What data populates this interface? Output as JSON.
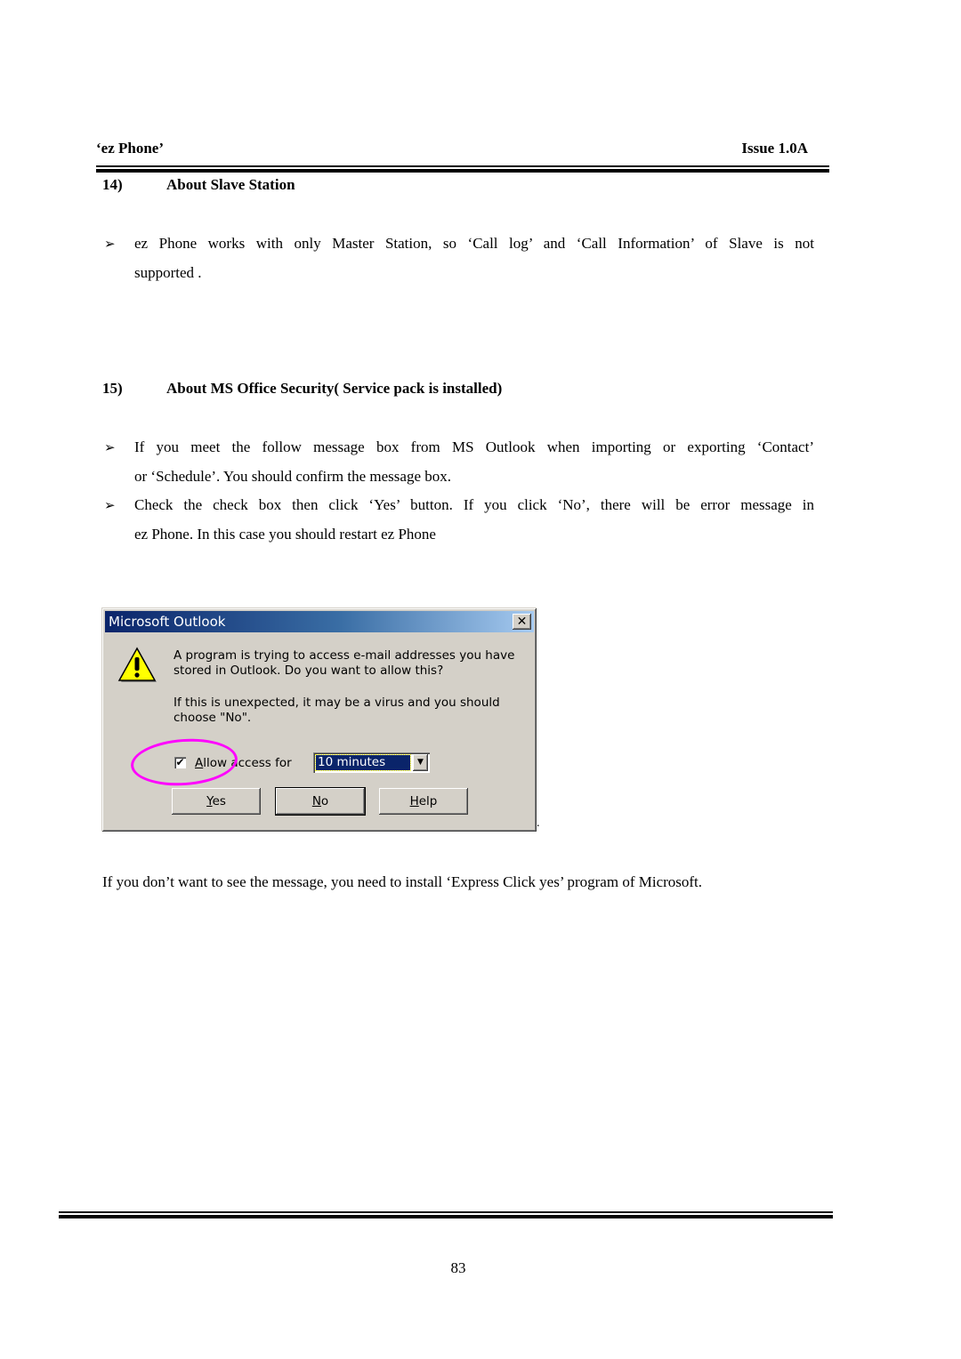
{
  "header": {
    "left": "‘ez Phone’",
    "right": "Issue 1.0A"
  },
  "sections": [
    {
      "number": "14)",
      "title": "About Slave Station",
      "bullets": [
        {
          "lines": [
            "ez Phone works with only Master Station, so ‘Call log’ and ‘Call Information’ of Slave is not",
            "supported ."
          ]
        }
      ]
    },
    {
      "number": "15)",
      "title": "About MS Office Security( Service pack is installed)",
      "bullets": [
        {
          "lines": [
            "If you meet the follow message box from MS Outlook when importing or exporting ‘Contact’",
            "or ‘Schedule’. You should confirm the message box."
          ]
        },
        {
          "lines": [
            "Check the check box then click ‘Yes’ button. If you click ‘No’, there will be error message in",
            "ez Phone. In this case you should restart ez Phone"
          ]
        }
      ]
    }
  ],
  "bullet_glyph": "➢",
  "dialog": {
    "title": "Microsoft Outlook",
    "close_glyph": "✕",
    "icon": "warning-icon",
    "message_1_line_1": "A program is trying to access e-mail addresses you have",
    "message_1_line_2": "stored in Outlook.  Do you want to allow this?",
    "message_2_line_1": "If this is unexpected, it may be a virus and you should",
    "message_2_line_2": "choose \"No\".",
    "checkbox": {
      "checked": true,
      "glyph": "✔",
      "label_accel": "A",
      "label_rest": "llow access for"
    },
    "duration_select": {
      "value": "10 minutes",
      "arrow_glyph": "▼"
    },
    "buttons": [
      {
        "accel": "Y",
        "rest": "es"
      },
      {
        "accel": "N",
        "rest": "o"
      },
      {
        "accel": "H",
        "rest": "elp"
      }
    ],
    "highlight_color": "#ff00ff"
  },
  "trailing_mark": ".",
  "closing_text": "If you don’t want to see the message, you need to install ‘Express Click yes’ program of Microsoft.",
  "footer": {
    "page_number": "83"
  }
}
